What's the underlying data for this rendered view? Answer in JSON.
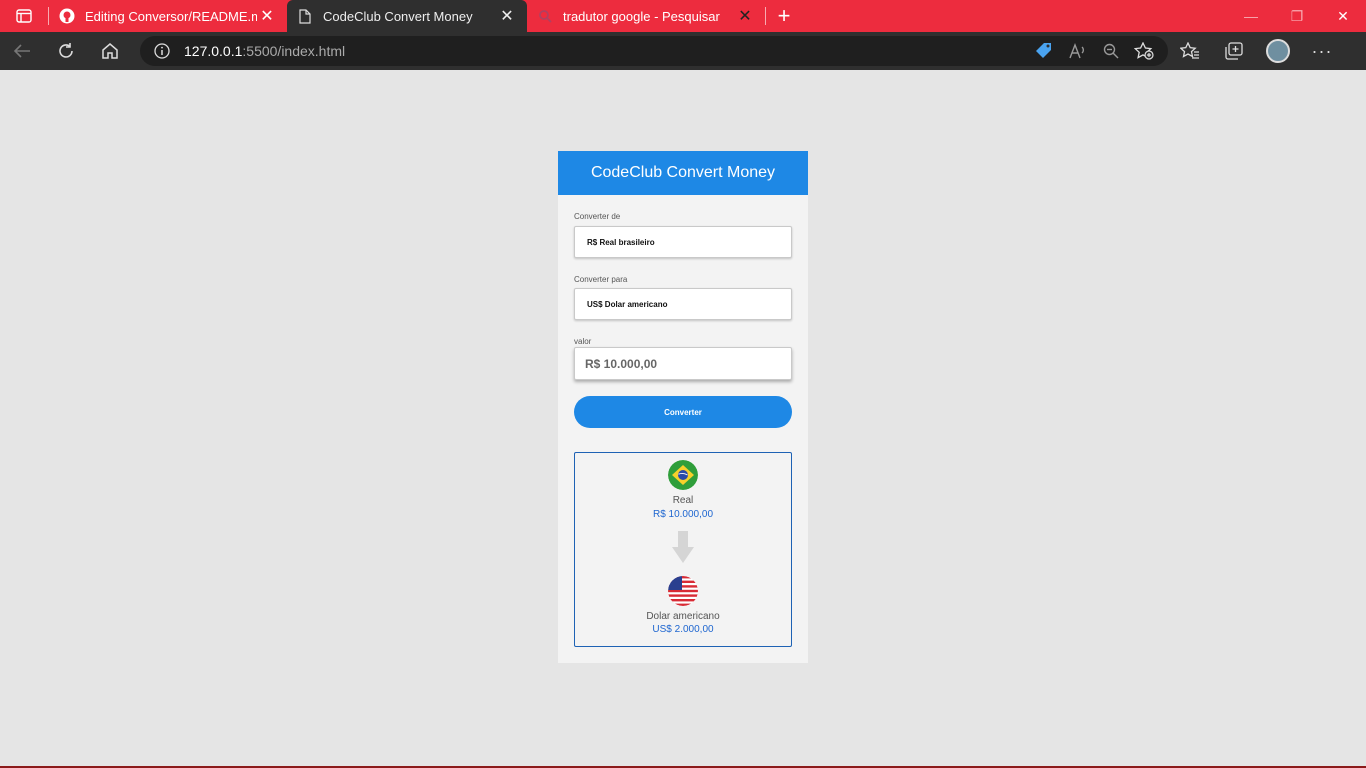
{
  "browser": {
    "tabs": [
      {
        "title": "Editing Conversor/README.md a",
        "icon": "github-icon"
      },
      {
        "title": "CodeClub Convert Money",
        "icon": "page-icon"
      },
      {
        "title": "tradutor google - Pesquisar",
        "icon": "search-icon"
      }
    ],
    "url_host": "127.0.0.1",
    "url_path": ":5500/index.html",
    "accent_color": "#ed2c3e"
  },
  "app": {
    "title": "CodeClub Convert Money",
    "from_label": "Converter de",
    "from_value": "R$ Real brasileiro",
    "to_label": "Converter para",
    "to_value": "US$ Dolar americano",
    "amount_label": "valor",
    "amount_value": "R$ 10.000,00",
    "button_label": "Converter",
    "accent_color": "#1e88e5"
  },
  "result": {
    "from_currency": "Real",
    "from_amount": "R$ 10.000,00",
    "to_currency": "Dolar americano",
    "to_amount": "US$ 2.000,00"
  }
}
